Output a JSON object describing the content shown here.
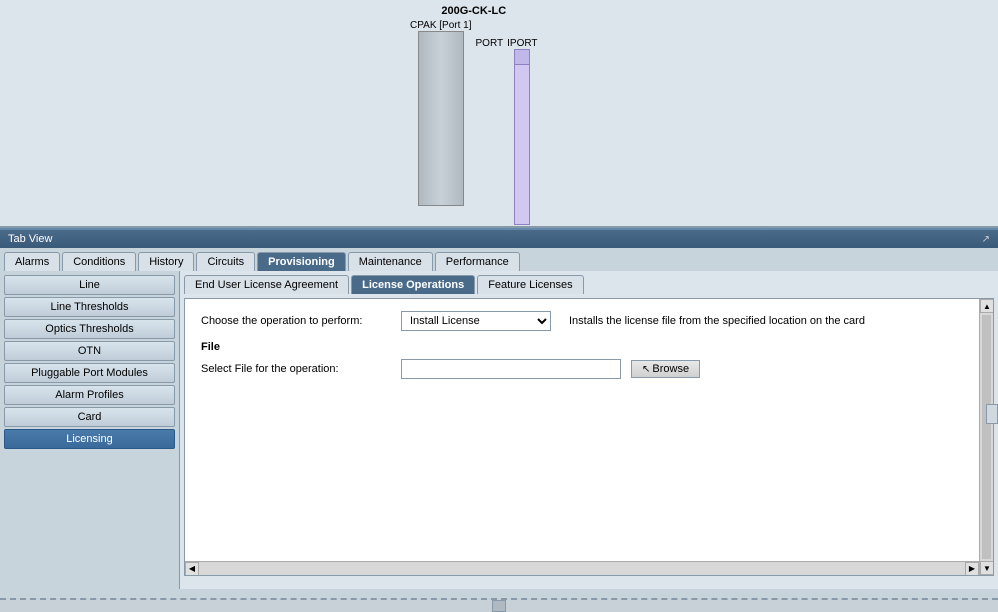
{
  "diagram": {
    "device_name": "200G-CK-LC",
    "port1_label": "CPAK [Port 1]",
    "port2_label": "PORT",
    "port3_label": "IPORT"
  },
  "tab_view": {
    "title": "Tab View",
    "expand_icon": "↗"
  },
  "main_tabs": [
    {
      "label": "Alarms",
      "active": false
    },
    {
      "label": "Conditions",
      "active": false
    },
    {
      "label": "History",
      "active": false
    },
    {
      "label": "Circuits",
      "active": false
    },
    {
      "label": "Provisioning",
      "active": true
    },
    {
      "label": "Maintenance",
      "active": false
    },
    {
      "label": "Performance",
      "active": false
    }
  ],
  "sidebar": {
    "items": [
      {
        "label": "Line",
        "active": false
      },
      {
        "label": "Line Thresholds",
        "active": false
      },
      {
        "label": "Optics Thresholds",
        "active": false
      },
      {
        "label": "OTN",
        "active": false
      },
      {
        "label": "Pluggable Port Modules",
        "active": false
      },
      {
        "label": "Alarm Profiles",
        "active": false
      },
      {
        "label": "Card",
        "active": false
      },
      {
        "label": "Licensing",
        "active": true
      }
    ]
  },
  "sub_tabs": [
    {
      "label": "End User License Agreement",
      "active": false
    },
    {
      "label": "License Operations",
      "active": true
    },
    {
      "label": "Feature Licenses",
      "active": false
    }
  ],
  "panel": {
    "operation_label": "Choose the operation to perform:",
    "operation_value": "Install License",
    "operation_description": "Installs the license file from the specified location on the card",
    "file_section_label": "File",
    "file_select_label": "Select File for the operation:",
    "browse_label": "Browse"
  },
  "bottom": {
    "resize_handle": "▲"
  }
}
